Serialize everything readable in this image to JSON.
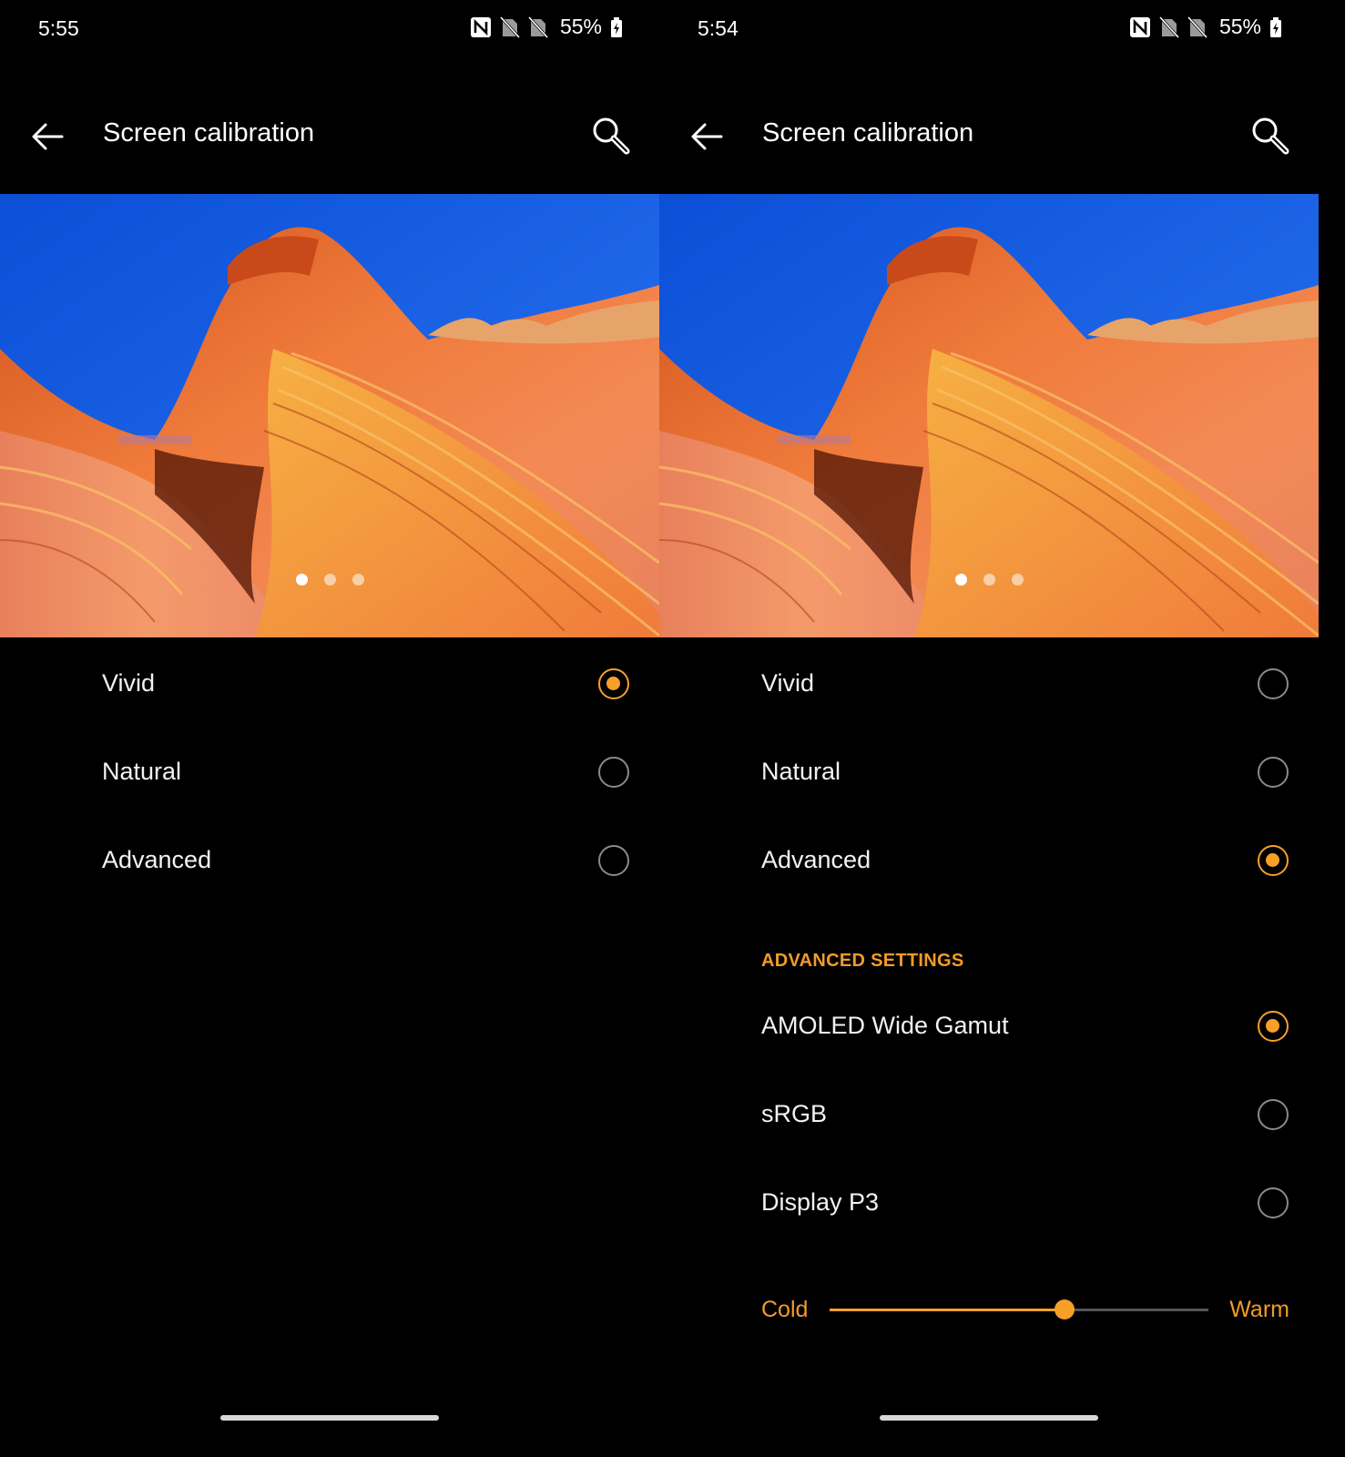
{
  "colors": {
    "accent": "#f6a02a",
    "background": "#000000"
  },
  "screens": [
    {
      "status_bar": {
        "time": "5:55",
        "battery": "55%",
        "icons": [
          "nfc-icon",
          "no-sim-icon",
          "no-sim-icon",
          "battery-icon"
        ]
      },
      "app_bar": {
        "title": "Screen calibration",
        "back_icon": "back-arrow-icon",
        "search_icon": "search-icon"
      },
      "preview": {
        "page_count": 3,
        "active_page": 1
      },
      "modes": [
        {
          "label": "Vivid",
          "selected": true
        },
        {
          "label": "Natural",
          "selected": false
        },
        {
          "label": "Advanced",
          "selected": false
        }
      ]
    },
    {
      "status_bar": {
        "time": "5:54",
        "battery": "55%",
        "icons": [
          "nfc-icon",
          "no-sim-icon",
          "no-sim-icon",
          "battery-icon"
        ]
      },
      "app_bar": {
        "title": "Screen calibration",
        "back_icon": "back-arrow-icon",
        "search_icon": "search-icon"
      },
      "preview": {
        "page_count": 3,
        "active_page": 1
      },
      "modes": [
        {
          "label": "Vivid",
          "selected": false
        },
        {
          "label": "Natural",
          "selected": false
        },
        {
          "label": "Advanced",
          "selected": true
        }
      ],
      "advanced_settings": {
        "header": "ADVANCED SETTINGS",
        "gamuts": [
          {
            "label": "AMOLED Wide Gamut",
            "selected": true
          },
          {
            "label": "sRGB",
            "selected": false
          },
          {
            "label": "Display P3",
            "selected": false
          }
        ],
        "temperature": {
          "min_label": "Cold",
          "max_label": "Warm",
          "value": 0.62
        }
      }
    }
  ]
}
